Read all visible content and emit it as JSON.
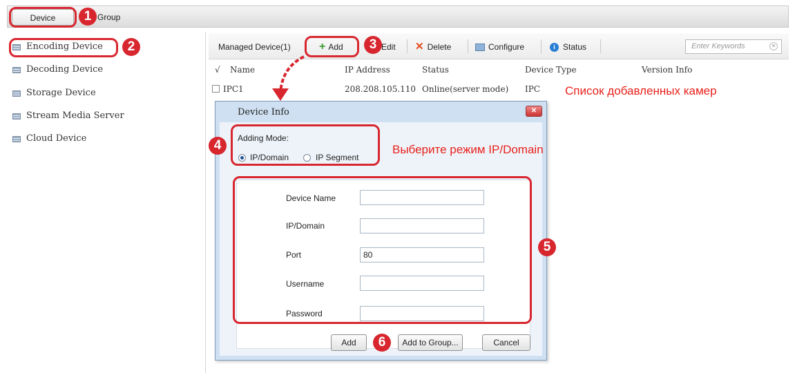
{
  "topbar": {
    "tab_device": "Device",
    "tab_group": "Group"
  },
  "sidebar": {
    "items": [
      {
        "label": "Encoding Device"
      },
      {
        "label": "Decoding Device"
      },
      {
        "label": "Storage Device"
      },
      {
        "label": "Stream Media Server"
      },
      {
        "label": "Cloud Device"
      }
    ]
  },
  "toolbar": {
    "managed": "Managed Device(1)",
    "add": "Add",
    "edit": "Edit",
    "delete": "Delete",
    "configure": "Configure",
    "status": "Status",
    "search_placeholder": "Enter Keywords"
  },
  "table": {
    "columns": [
      "√",
      "Name",
      "IP Address",
      "Status",
      "Device Type",
      "Version Info"
    ],
    "rows": [
      {
        "name": "IPC1",
        "ip": "208.208.105.110",
        "status": "Online(server mode)",
        "type": "IPC"
      }
    ]
  },
  "annotations": {
    "camera_list": "Список добавленных камер",
    "select_mode": "Выберите режим IP/Domain",
    "n1": "1",
    "n2": "2",
    "n3": "3",
    "n4": "4",
    "n5": "5",
    "n6": "6"
  },
  "dialog": {
    "title": "Device Info",
    "adding_mode_label": "Adding Mode:",
    "mode_ip_domain": "IP/Domain",
    "mode_ip_segment": "IP Segment",
    "fields": [
      {
        "label": "Device Name",
        "value": ""
      },
      {
        "label": "IP/Domain",
        "value": ""
      },
      {
        "label": "Port",
        "value": "80"
      },
      {
        "label": "Username",
        "value": ""
      },
      {
        "label": "Password",
        "value": ""
      }
    ],
    "btn_add": "Add",
    "btn_add_group": "Add to Group...",
    "btn_cancel": "Cancel"
  },
  "colors": {
    "annotation_red": "#d8262f",
    "note_red": "#e8201a",
    "dialog_bg": "#cfe0f2"
  }
}
